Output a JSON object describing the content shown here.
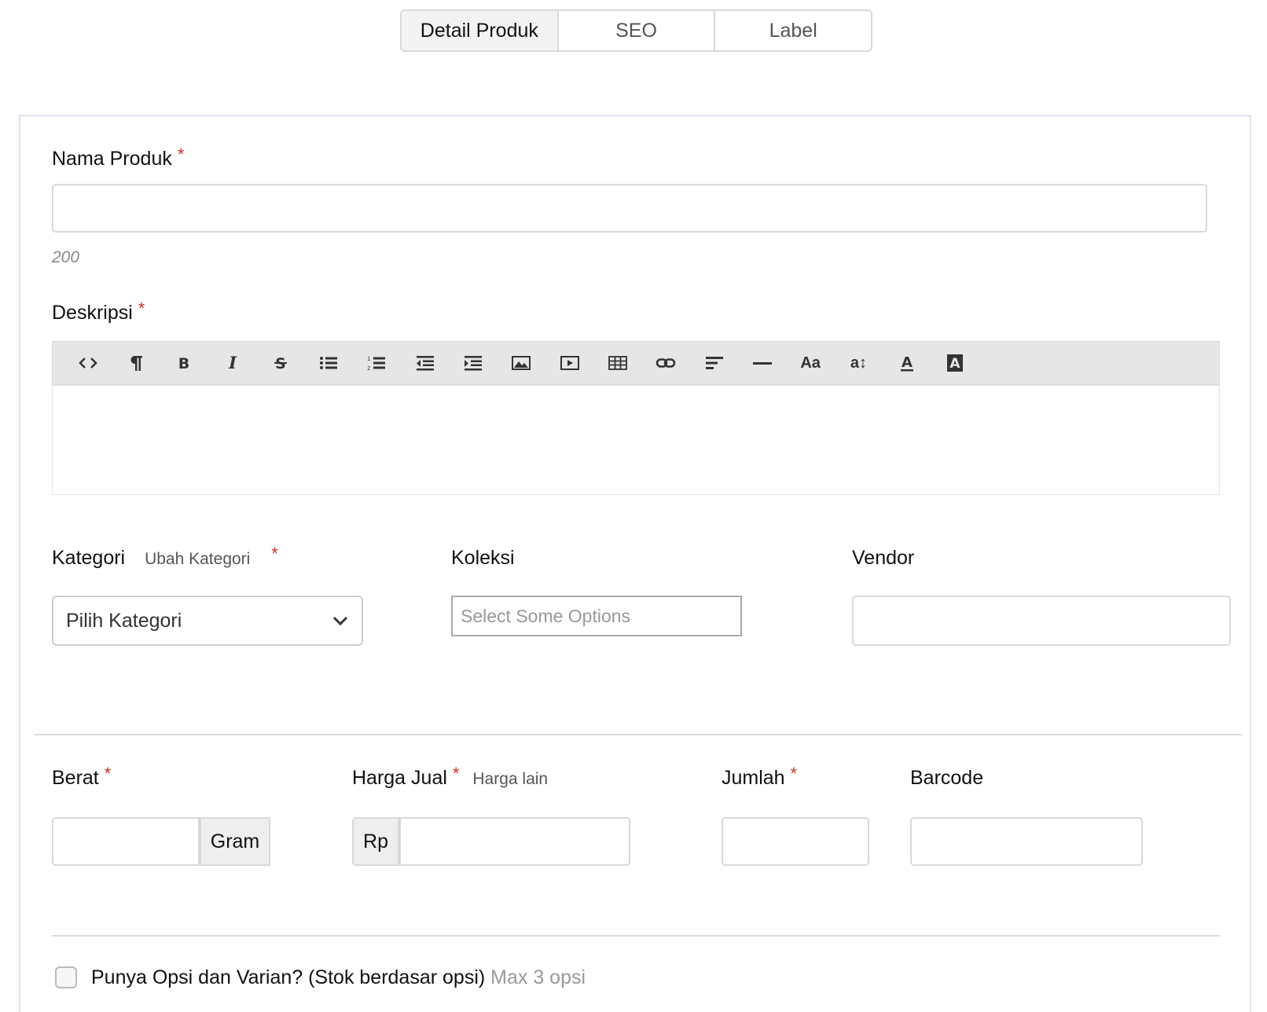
{
  "tabs": [
    {
      "label": "Detail Produk",
      "active": true
    },
    {
      "label": "SEO",
      "active": false
    },
    {
      "label": "Label",
      "active": false
    }
  ],
  "form": {
    "required_mark": "*",
    "nama_produk": {
      "label": "Nama Produk",
      "value": "",
      "counter": "200"
    },
    "deskripsi": {
      "label": "Deskripsi",
      "content": ""
    },
    "toolbar": [
      {
        "name": "code-view-icon"
      },
      {
        "name": "paragraph-icon"
      },
      {
        "name": "bold-icon"
      },
      {
        "name": "italic-icon"
      },
      {
        "name": "strikethrough-icon"
      },
      {
        "name": "bulleted-list-icon"
      },
      {
        "name": "numbered-list-icon"
      },
      {
        "name": "outdent-icon"
      },
      {
        "name": "indent-icon"
      },
      {
        "name": "image-icon"
      },
      {
        "name": "video-icon"
      },
      {
        "name": "table-icon"
      },
      {
        "name": "link-icon"
      },
      {
        "name": "align-left-icon"
      },
      {
        "name": "horizontal-rule-icon"
      },
      {
        "name": "font-family-icon",
        "text": "Aa"
      },
      {
        "name": "font-size-icon",
        "text": "a↕"
      },
      {
        "name": "text-color-icon"
      },
      {
        "name": "background-color-icon"
      }
    ],
    "kategori": {
      "label": "Kategori",
      "change_link": "Ubah Kategori",
      "selected": "Pilih Kategori"
    },
    "koleksi": {
      "label": "Koleksi",
      "placeholder": "Select Some Options"
    },
    "vendor": {
      "label": "Vendor",
      "value": ""
    },
    "berat": {
      "label": "Berat",
      "unit": "Gram",
      "value": ""
    },
    "harga_jual": {
      "label": "Harga Jual",
      "link": "Harga lain",
      "prefix": "Rp",
      "value": ""
    },
    "jumlah": {
      "label": "Jumlah",
      "value": ""
    },
    "barcode": {
      "label": "Barcode",
      "value": ""
    },
    "opsi": {
      "label": "Punya Opsi dan Varian? (Stok berdasar opsi)",
      "hint": "Max 3 opsi",
      "checked": false
    }
  }
}
